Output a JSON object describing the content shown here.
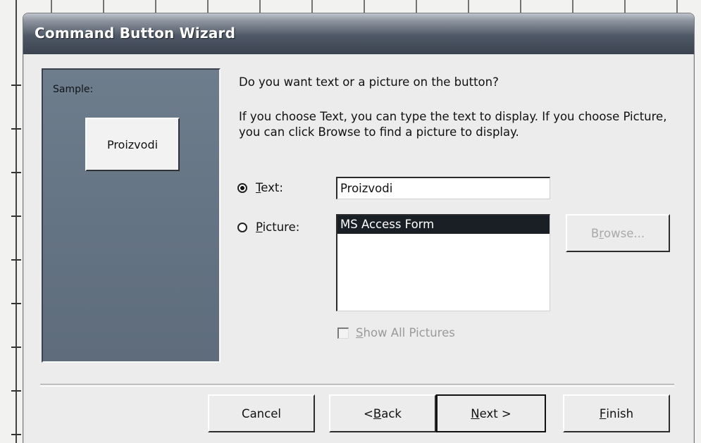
{
  "window": {
    "title": "Command Button Wizard"
  },
  "sample": {
    "label": "Sample:",
    "button_text": "Proizvodi"
  },
  "content": {
    "question": "Do you want text or a picture on the button?",
    "explanation": "If you choose Text, you can type the text to display. If you choose Picture, you can click Browse to find a picture to display."
  },
  "options": {
    "text": {
      "label_prefix": "",
      "label_underlined": "T",
      "label_rest": "ext:",
      "selected": true
    },
    "picture": {
      "label_prefix": "",
      "label_underlined": "P",
      "label_rest": "icture:",
      "selected": false
    }
  },
  "text_field": {
    "value": "Proizvodi"
  },
  "picture_list": {
    "items": [
      "MS Access Form"
    ],
    "selected_item": "MS Access Form"
  },
  "browse_button": {
    "label_prefix": "B",
    "label_underlined": "r",
    "label_rest": "owse...",
    "enabled": false
  },
  "show_all_pictures": {
    "label_prefix": "",
    "label_underlined": "S",
    "label_rest": "how All Pictures",
    "checked": false,
    "enabled": false
  },
  "footer": {
    "cancel": "Cancel",
    "back_prefix": "< ",
    "back_underlined": "B",
    "back_rest": "ack",
    "next_underlined": "N",
    "next_rest": "ext >",
    "finish_underlined": "F",
    "finish_rest": "inish"
  },
  "colors": {
    "titlebar_dark": "#3b4350",
    "sample_panel": "#657484",
    "selected_item_bg": "#1a1f26"
  }
}
